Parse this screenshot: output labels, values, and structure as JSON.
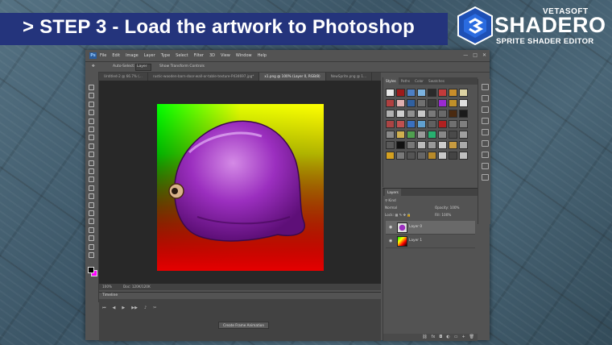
{
  "banner": {
    "title": "> STEP 3 - Load the artwork to Photoshop"
  },
  "logo": {
    "brand": "VETASOFT",
    "product": "SHADERO",
    "tagline": "SPRITE SHADER EDITOR"
  },
  "menu": {
    "app_icon": "Ps",
    "items": [
      "File",
      "Edit",
      "Image",
      "Layer",
      "Type",
      "Select",
      "Filter",
      "3D",
      "View",
      "Window",
      "Help"
    ]
  },
  "window_controls": [
    "—",
    "□",
    "✕"
  ],
  "options_bar": {
    "auto_select": "Auto-Select:",
    "auto_select_value": "Layer",
    "show_transform": "Show Transform Controls"
  },
  "doc_tabs": [
    {
      "label": "Untitled-2 @ 66.7% (...",
      "active": false
    },
    {
      "label": "rustic-wooden-barn-door-wall-or-table-texture-P434697.jpg*",
      "active": false
    },
    {
      "label": "x1.png @ 100% (Layer 0, RGB/8)",
      "active": true
    },
    {
      "label": "NewSprite.png @ 1...",
      "active": false
    }
  ],
  "status": {
    "zoom": "100%",
    "doc": "Doc: 120K/120K"
  },
  "timeline": {
    "title": "Timeline",
    "create_button": "Create Frame Animation"
  },
  "styles_panel": {
    "tabs": [
      "Styles",
      "Paths",
      "Color",
      "Swatches"
    ],
    "swatch_colors": [
      "#e8e8e8",
      "#9c1b1b",
      "#4d7fc4",
      "#7cb3e0",
      "#2a2a2a",
      "#c23b3b",
      "#c88d2b",
      "#dcd2a3",
      "#b04040",
      "#e0b0b0",
      "#3060a0",
      "#707070",
      "#3c3c3c",
      "#9a2ad0",
      "#c0902a",
      "#e0e0e0",
      "#b0b0b0",
      "#d0d0d0",
      "#909090",
      "#c8c8c8",
      "#7a7a7a",
      "#6a6a6a",
      "#4a2a10",
      "#1a1a1a",
      "#aa4444",
      "#c05050",
      "#3a70c0",
      "#60a0d0",
      "#606060",
      "#b02020",
      "#707070",
      "#808080",
      "#8a8a8a",
      "#d0b050",
      "#50a050",
      "#9a9a9a",
      "#28b070",
      "#888888",
      "#4a4a4a",
      "#a0a0a0",
      "#5a5a5a",
      "#111111",
      "#787878",
      "#bbbbbb",
      "#999999",
      "#cccccc",
      "#c89b40",
      "#aaaaaa",
      "#d4a020",
      "#7a7a7a",
      "#555555",
      "#666666",
      "#b88a2a",
      "#c8c8c8",
      "#444444",
      "#c0c0c0"
    ]
  },
  "layers_panel": {
    "tab": "Layers",
    "kind": "Kind",
    "blend": "Normal",
    "opacity_label": "Opacity:",
    "opacity_value": "100%",
    "lock_label": "Lock:",
    "fill_label": "Fill:",
    "fill_value": "100%",
    "layers": [
      {
        "name": "Layer 0",
        "selected": true
      },
      {
        "name": "Layer 1",
        "selected": false
      }
    ]
  },
  "colors": {
    "accent_banner": "#24347c",
    "canvas_bg": "#282828",
    "ps_bg": "#535353"
  }
}
